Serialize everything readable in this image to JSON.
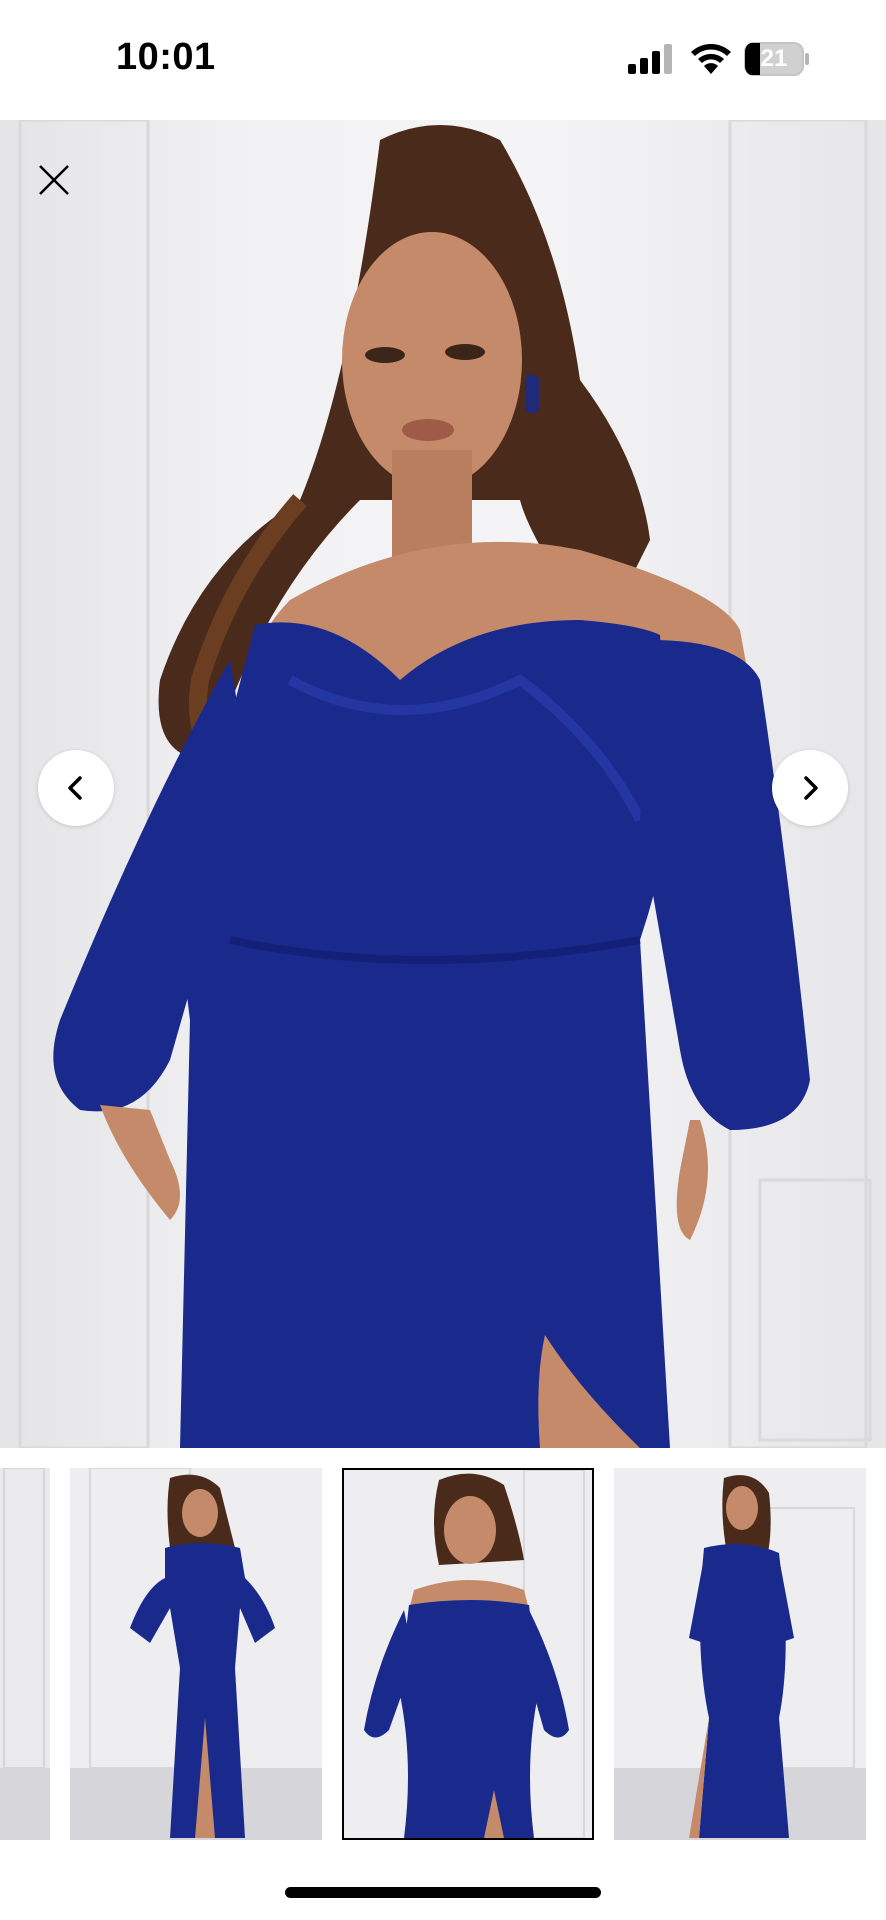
{
  "status_bar": {
    "time": "10:01",
    "battery_level": "21",
    "icons": [
      "signal-icon",
      "wifi-icon",
      "battery-icon"
    ]
  },
  "product_viewer": {
    "main_image": {
      "subject": "model-in-navy-off-shoulder-gown",
      "selected_index": 2
    },
    "controls": {
      "close_icon": "close-icon",
      "prev_icon": "chevron-left-icon",
      "next_icon": "chevron-right-icon"
    },
    "thumbnails": [
      {
        "view": "partial",
        "selected": false
      },
      {
        "view": "front-full-length",
        "selected": false
      },
      {
        "view": "front-close-up",
        "selected": true
      },
      {
        "view": "back-full-length",
        "selected": false
      }
    ]
  },
  "colors": {
    "dress": "#1a2a8c",
    "background": "#f2f2f4",
    "selected_border": "#000000"
  }
}
